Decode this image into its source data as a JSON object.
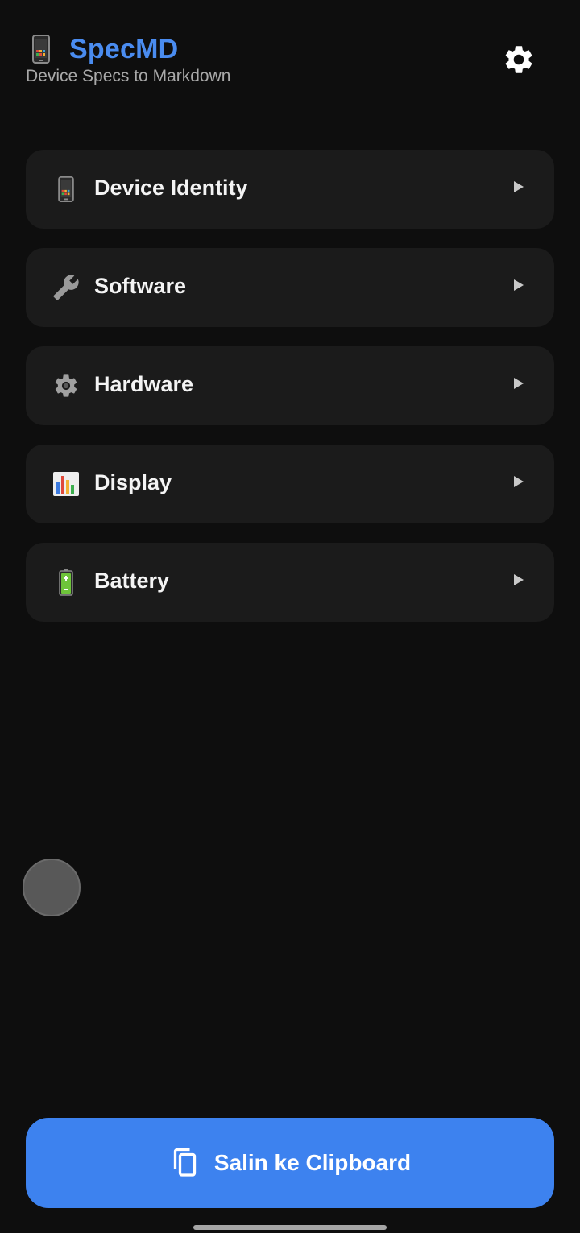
{
  "header": {
    "app_name": "SpecMD",
    "subtitle": "Device Specs to Markdown",
    "logo_icon": "mobile-phone-icon",
    "settings_icon": "gear-icon"
  },
  "menu": {
    "items": [
      {
        "label": "Device Identity",
        "icon": "mobile-phone-icon"
      },
      {
        "label": "Software",
        "icon": "wrench-icon"
      },
      {
        "label": "Hardware",
        "icon": "gear-icon"
      },
      {
        "label": "Display",
        "icon": "bar-chart-icon"
      },
      {
        "label": "Battery",
        "icon": "battery-icon"
      }
    ],
    "chevron_icon": "play-arrow-icon"
  },
  "floating_bubble": {
    "icon": "floating-bubble"
  },
  "copy_button": {
    "label": "Salin ke Clipboard",
    "icon": "copy-icon"
  },
  "colors": {
    "background": "#0e0e0e",
    "card": "#1b1b1b",
    "accent": "#3d82ef",
    "title": "#4a8cf0",
    "subtitle": "#a9a9a9"
  }
}
